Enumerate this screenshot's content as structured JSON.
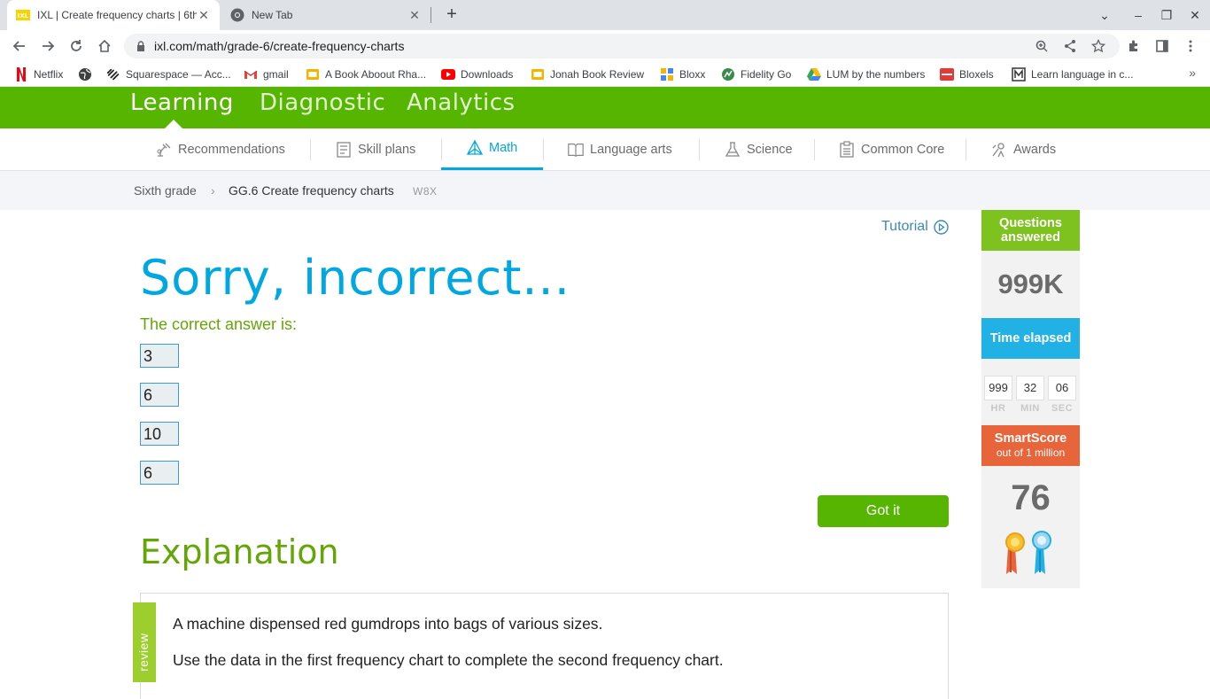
{
  "browser": {
    "tabs": [
      {
        "title": "IXL | Create frequency charts | 6th",
        "active": true
      },
      {
        "title": "New Tab",
        "active": false
      }
    ],
    "url": "ixl.com/math/grade-6/create-frequency-charts",
    "bookmarks": [
      {
        "label": "Netflix",
        "icon": "netflix-icon"
      },
      {
        "label": "",
        "icon": "globe-icon"
      },
      {
        "label": "Squarespace — Acc...",
        "icon": "squarespace-icon"
      },
      {
        "label": "gmail",
        "icon": "gmail-icon"
      },
      {
        "label": "A Book Aboout Rha...",
        "icon": "slides-icon"
      },
      {
        "label": "Downloads",
        "icon": "youtube-icon"
      },
      {
        "label": "Jonah Book Review",
        "icon": "slides-icon"
      },
      {
        "label": "Bloxx",
        "icon": "bloxx-icon"
      },
      {
        "label": "Fidelity Go",
        "icon": "fidelity-icon"
      },
      {
        "label": "LUM by the numbers",
        "icon": "drive-icon"
      },
      {
        "label": "Bloxels",
        "icon": "bloxels-icon"
      },
      {
        "label": "Learn language in c...",
        "icon": "learn-icon"
      }
    ]
  },
  "ixl": {
    "topnav": [
      "Learning",
      "Diagnostic",
      "Analytics"
    ],
    "subnav": [
      {
        "label": "Recommendations",
        "icon": "recommendations-icon"
      },
      {
        "label": "Skill plans",
        "icon": "skill-plans-icon"
      },
      {
        "label": "Math",
        "icon": "math-icon"
      },
      {
        "label": "Language arts",
        "icon": "language-arts-icon"
      },
      {
        "label": "Science",
        "icon": "science-icon"
      },
      {
        "label": "Common Core",
        "icon": "common-core-icon"
      },
      {
        "label": "Awards",
        "icon": "awards-icon"
      }
    ],
    "breadcrumb": {
      "grade": "Sixth grade",
      "skill": "GG.6 Create frequency charts",
      "code": "W8X"
    }
  },
  "main": {
    "tutorial": "Tutorial",
    "headline": "Sorry, incorrect...",
    "correct_label": "The correct answer is:",
    "answers": [
      "3",
      "6",
      "10",
      "6"
    ],
    "got_it": "Got it",
    "explanation_title": "Explanation",
    "review_tag": "review",
    "explanation_lines": [
      "A machine dispensed red gumdrops into bags of various sizes.",
      "Use the data in the first frequency chart to complete the second frequency chart."
    ]
  },
  "sidebar": {
    "questions_label": "Questions answered",
    "questions_value": "999K",
    "time_label": "Time elapsed",
    "time": {
      "hr": "999",
      "min": "32",
      "sec": "06"
    },
    "time_units": {
      "hr": "HR",
      "min": "MIN",
      "sec": "SEC"
    },
    "smartscore_label": "SmartScore",
    "smartscore_sub": "out of 1 million",
    "smartscore_value": "76"
  },
  "colors": {
    "ixl_green": "#56b500",
    "ixl_blue": "#00a7e1",
    "smartscore_orange": "#e8643a",
    "questions_green": "#7dc21e"
  }
}
